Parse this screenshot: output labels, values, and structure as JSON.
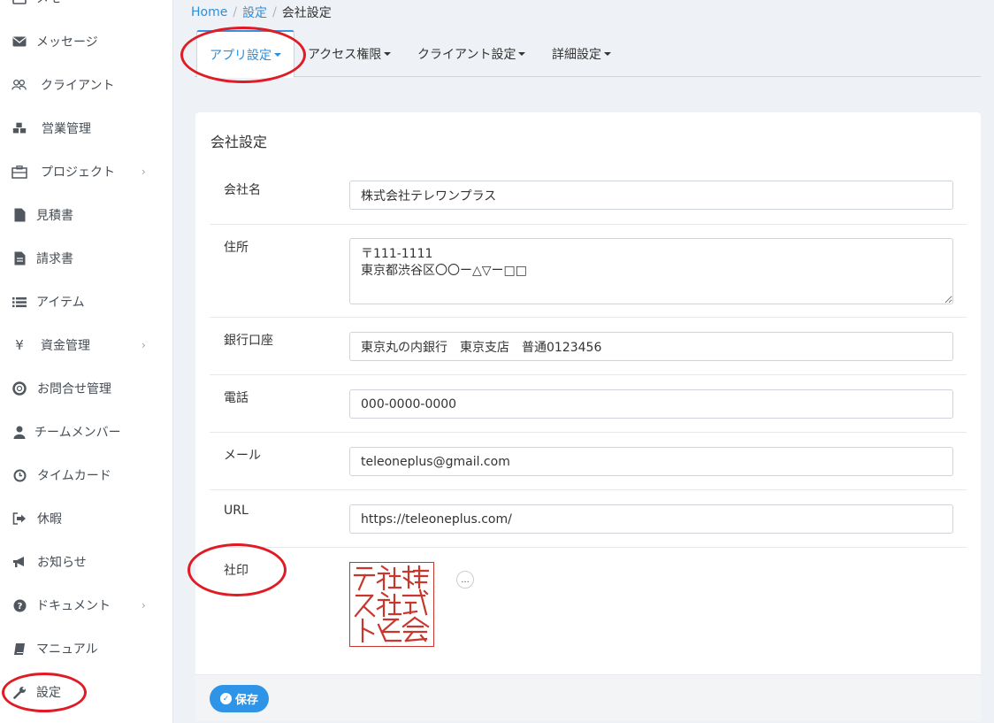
{
  "sidebar": {
    "items": [
      {
        "label": "メモ",
        "icon": "note-icon"
      },
      {
        "label": "メッセージ",
        "icon": "envelope-icon"
      },
      {
        "label": "クライアント",
        "icon": "users-icon"
      },
      {
        "label": "営業管理",
        "icon": "cubes-icon"
      },
      {
        "label": "プロジェクト",
        "icon": "briefcase-icon",
        "chevron": "›"
      },
      {
        "label": "見積書",
        "icon": "file-icon"
      },
      {
        "label": "請求書",
        "icon": "file-text-icon"
      },
      {
        "label": "アイテム",
        "icon": "list-icon"
      },
      {
        "label": "資金管理",
        "icon": "yen-icon",
        "chevron": "›"
      },
      {
        "label": "お問合せ管理",
        "icon": "lifebuoy-icon"
      },
      {
        "label": "チームメンバー",
        "icon": "user-icon"
      },
      {
        "label": "タイムカード",
        "icon": "clock-icon"
      },
      {
        "label": "休暇",
        "icon": "sign-out-icon"
      },
      {
        "label": "お知らせ",
        "icon": "bullhorn-icon"
      },
      {
        "label": "ドキュメント",
        "icon": "question-circle-icon",
        "chevron": "›"
      },
      {
        "label": "マニュアル",
        "icon": "book-icon"
      },
      {
        "label": "設定",
        "icon": "wrench-icon"
      }
    ]
  },
  "breadcrumb": {
    "home": "Home",
    "settings": "設定",
    "current": "会社設定"
  },
  "tabs": [
    {
      "label": "アプリ設定"
    },
    {
      "label": "アクセス権限"
    },
    {
      "label": "クライアント設定"
    },
    {
      "label": "詳細設定"
    }
  ],
  "card": {
    "title": "会社設定",
    "fields": {
      "company_name": {
        "label": "会社名",
        "value": "株式会社テレワンプラス"
      },
      "address": {
        "label": "住所",
        "value": "〒111-1111\n東京都渋谷区〇〇ー△▽ー□□"
      },
      "bank": {
        "label": "銀行口座",
        "value": "東京丸の内銀行　東京支店　普通0123456"
      },
      "phone": {
        "label": "電話",
        "value": "000-0000-0000"
      },
      "email": {
        "label": "メール",
        "value": "teleoneplus@gmail.com"
      },
      "url": {
        "label": "URL",
        "value": "https://teleoneplus.com/"
      },
      "seal": {
        "label": "社印",
        "seal_text": "株式会社テスト",
        "more_label": "..."
      }
    },
    "save_label": "保存"
  },
  "colors": {
    "accent": "#2e8ed8",
    "seal": "#c8372d",
    "annotation": "#e01b24"
  }
}
